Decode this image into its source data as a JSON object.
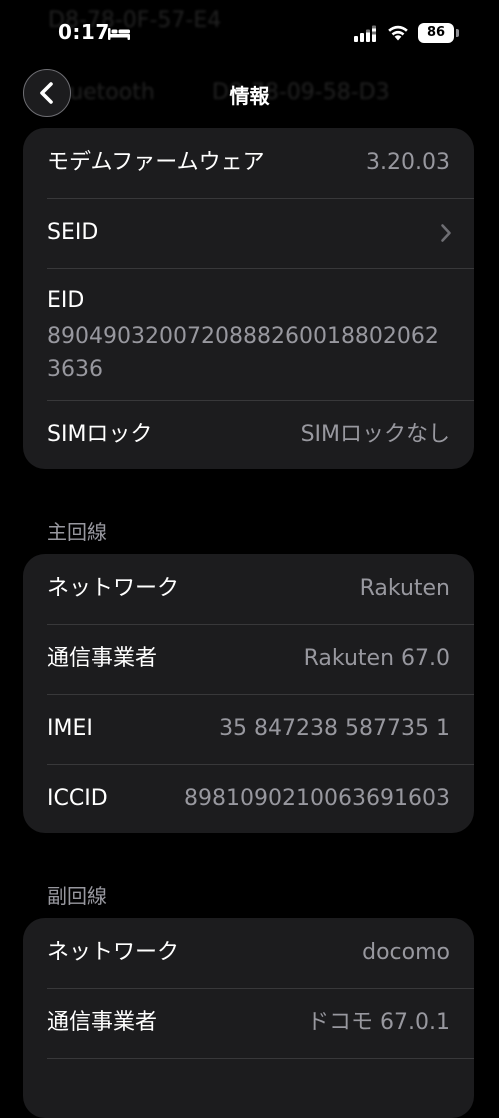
{
  "status_bar": {
    "time": "0:17",
    "battery": "86",
    "icons": [
      "bed-icon",
      "cellular-signal-icon",
      "wifi-icon",
      "battery-icon"
    ]
  },
  "background_rows": {
    "top": "D8-78-0F-57-E4",
    "bluetooth_label": "Bluetooth",
    "bluetooth_value": "D8-78-09-58-D3"
  },
  "nav": {
    "title": "情報",
    "back_icon": "chevron-left-icon"
  },
  "device_card": {
    "modem_label": "モデムファームウェア",
    "modem_value": "3.20.03",
    "seid_label": "SEID",
    "eid_label": "EID",
    "eid_value": "89049032007208882600188020623636",
    "simlock_label": "SIMロック",
    "simlock_value": "SIMロックなし"
  },
  "primary": {
    "header": "主回線",
    "network_label": "ネットワーク",
    "network_value": "Rakuten",
    "carrier_label": "通信事業者",
    "carrier_value": "Rakuten 67.0",
    "imei_label": "IMEI",
    "imei_value": "35 847238 587735 1",
    "iccid_label": "ICCID",
    "iccid_value": "8981090210063691603"
  },
  "secondary": {
    "header": "副回線",
    "network_label": "ネットワーク",
    "network_value": "docomo",
    "carrier_label": "通信事業者",
    "carrier_value": "ドコモ 67.0.1"
  },
  "colors": {
    "background": "#000000",
    "card": "#1c1c1e",
    "separator": "#38383a",
    "secondary_text": "#98989f",
    "primary_text": "#ffffff"
  }
}
